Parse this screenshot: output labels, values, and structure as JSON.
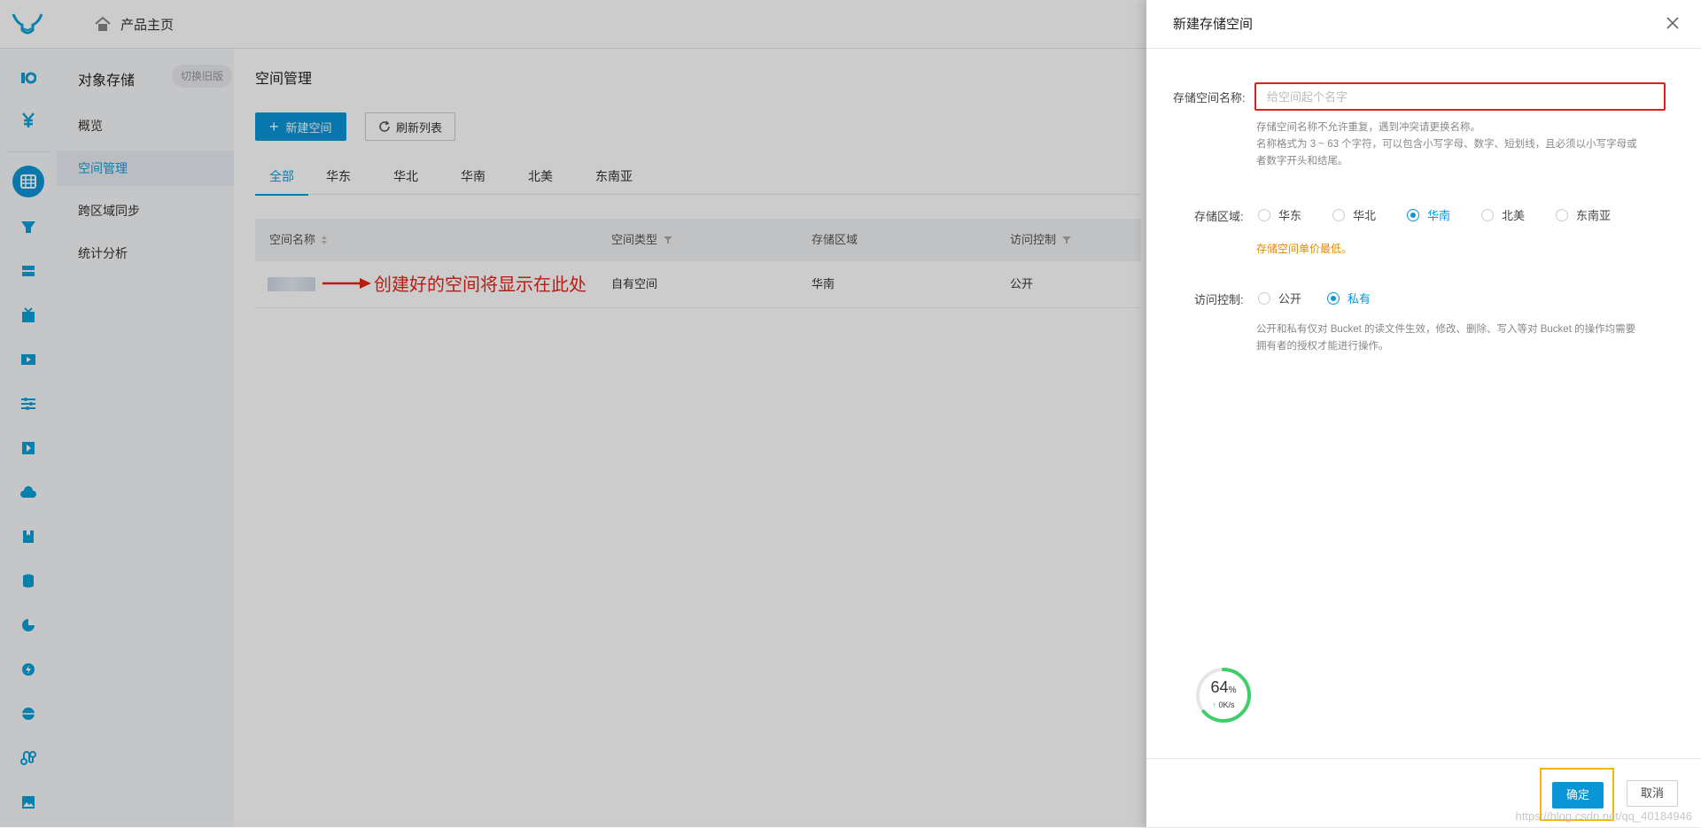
{
  "topbar": {
    "home_label": "产品主页"
  },
  "subnav": {
    "title": "对象存储",
    "switch_old": "切换旧版",
    "items": [
      {
        "label": "概览"
      },
      {
        "label": "空间管理"
      },
      {
        "label": "跨区域同步"
      },
      {
        "label": "统计分析"
      }
    ]
  },
  "main": {
    "title": "空间管理",
    "new_button": "新建空间",
    "refresh_button": "刷新列表",
    "tabs": [
      "全部",
      "华东",
      "华北",
      "华南",
      "北美",
      "东南亚"
    ],
    "columns": [
      "空间名称",
      "空间类型",
      "存储区域",
      "访问控制"
    ],
    "rows": [
      {
        "type": "自有空间",
        "region": "华南",
        "access": "公开"
      }
    ],
    "annotation": "创建好的空间将显示在此处"
  },
  "drawer": {
    "title": "新建存储空间",
    "name_label": "存储空间名称:",
    "name_placeholder": "给空间起个名字",
    "name_help_1": "存储空间名称不允许重复，遇到冲突请更换名称。",
    "name_help_2": "名称格式为 3 ~ 63 个字符，可以包含小写字母、数字、短划线，且必须以小写字母或",
    "name_help_3": "者数字开头和结尾。",
    "region_label": "存储区域:",
    "regions": [
      "华东",
      "华北",
      "华南",
      "北美",
      "东南亚"
    ],
    "region_selected": "华南",
    "region_tip": "存储空间单价最低。",
    "access_label": "访问控制:",
    "access_options": [
      "公开",
      "私有"
    ],
    "access_selected": "私有",
    "access_help_1": "公开和私有仅对 Bucket 的读文件生效，修改、删除、写入等对 Bucket 的操作均需要",
    "access_help_2": "拥有者的授权才能进行操作。",
    "ok_button": "确定",
    "cancel_button": "取消"
  },
  "widget": {
    "percent": "64",
    "percent_unit": "%",
    "speed": "0K/s",
    "progress": 0.64
  },
  "watermark": "https://blog.csdn.net/qq_40184946",
  "colors": {
    "accent": "#0a95d6",
    "highlight_red": "#e02020",
    "highlight_yellow": "#f2b705",
    "tip_orange": "#e58a00"
  }
}
